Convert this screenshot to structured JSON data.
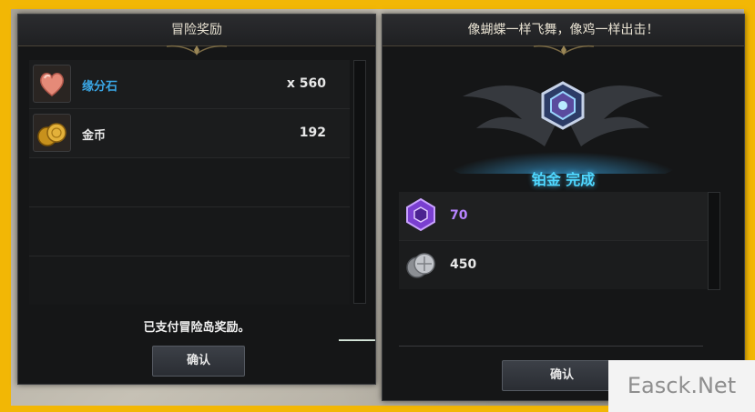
{
  "left_panel": {
    "title": "冒险奖励",
    "rewards": [
      {
        "name": "缘分石",
        "qty": "x 560",
        "name_color": "#3aa7e6",
        "icon": "heart-stone-icon"
      },
      {
        "name": "金币",
        "qty": "192",
        "name_color": "#e8e8e8",
        "icon": "gold-coins-icon"
      }
    ],
    "message": "已支付冒险岛奖励。",
    "confirm_label": "确认"
  },
  "right_panel": {
    "title": "像蝴蝶一样飞舞，像鸡一样出击！",
    "rank_text": "铂金 完成",
    "rank_icon": "platinum-emblem-icon",
    "rewards": [
      {
        "qty": "70",
        "qty_color": "#b784ff",
        "icon": "purple-gem-icon"
      },
      {
        "qty": "450",
        "qty_color": "#e8e8e8",
        "icon": "silver-coins-icon"
      }
    ],
    "confirm_label": "确认"
  },
  "watermark": "Easck.Net",
  "colors": {
    "frame": "#f2b705",
    "panel_bg": "#151617",
    "accent_blue": "#4fd8ff"
  }
}
